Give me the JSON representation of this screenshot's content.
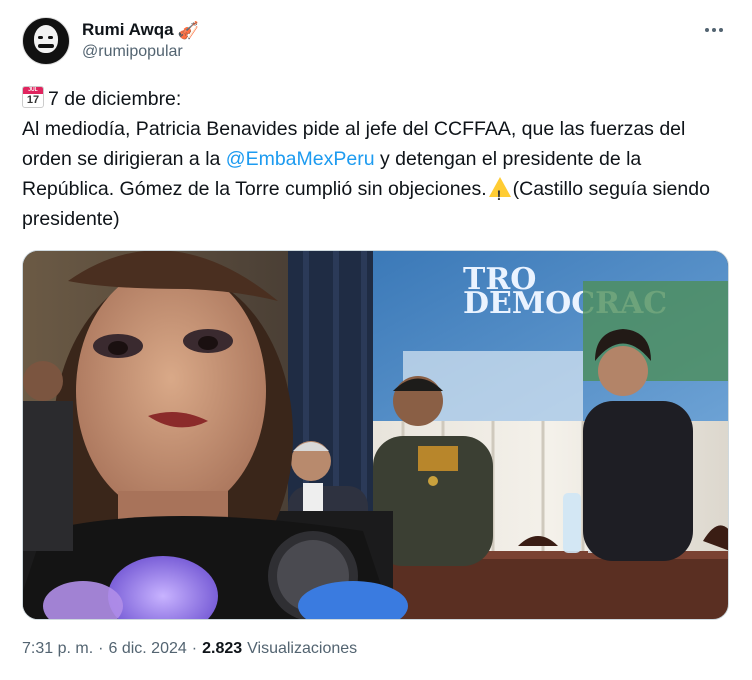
{
  "author": {
    "display_name": "Rumi Awqa",
    "handle": "@rumipopular",
    "badge_icon": "violin-icon"
  },
  "tweet": {
    "date_label": "7 de diciembre:",
    "calendar_icon_month": "JUL",
    "calendar_icon_day": "17",
    "text_part1": "Al mediodía, Patricia Benavides pide al jefe del CCFFAA, que las fuerzas del orden se dirigieran a la ",
    "mention": "@EmbaMexPeru",
    "text_part2": " y detengan el presidente de la República. Gómez de la Torre cumplió sin objeciones.",
    "text_part3": "(Castillo seguía siendo presidente)"
  },
  "media": {
    "screen_text_line1": "TRO",
    "screen_text_line2": "DEMOCRAC"
  },
  "meta": {
    "time": "7:31 p. m.",
    "separator": "·",
    "date": "6 dic. 2024",
    "views_count": "2.823",
    "views_label": "Visualizaciones"
  },
  "colors": {
    "link": "#1d9bf0",
    "secondary_text": "#536471",
    "primary_text": "#0f1419"
  }
}
